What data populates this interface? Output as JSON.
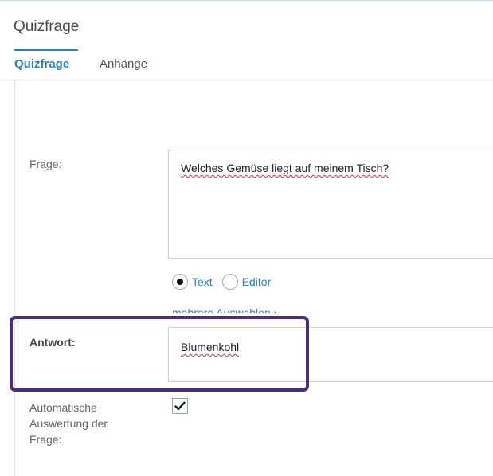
{
  "header": {
    "title": "Quizfrage"
  },
  "tabs": [
    {
      "label": "Quizfrage",
      "active": true
    },
    {
      "label": "Anhänge",
      "active": false
    }
  ],
  "form": {
    "question_label": "Frage:",
    "question_value": "Welches Gemüse liegt auf meinem Tisch?",
    "radio_options": [
      {
        "label": "Text",
        "selected": true
      },
      {
        "label": "Editor",
        "selected": false
      }
    ],
    "multi_select_link": "mehrere Auswahlen",
    "answer_label": "Antwort:",
    "answer_value": "Blumenkohl",
    "auto_eval_label_line1": "Automatische",
    "auto_eval_label_line2": "Auswertung der",
    "auto_eval_label_line3": "Frage:",
    "auto_eval_checked": true
  },
  "colors": {
    "accent": "#2b7fc3",
    "highlight_border": "#4b2d7f"
  },
  "icons": {
    "radio_selected": "radio-selected-icon",
    "radio_unselected": "radio-unselected-icon",
    "chevron": "chevron-right-icon",
    "check": "check-icon"
  }
}
